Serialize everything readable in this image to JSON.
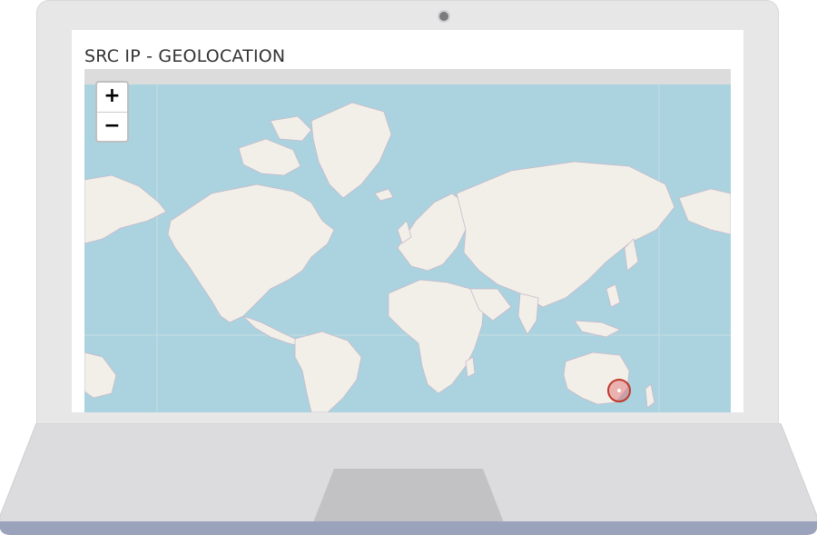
{
  "panel": {
    "title": "SRC IP - GEOLOCATION"
  },
  "map": {
    "zoom_in_label": "+",
    "zoom_out_label": "−",
    "colors": {
      "ocean": "#aad3df",
      "land": "#f2efe9",
      "border": "#c9a3c9",
      "marker_fill": "#e06666",
      "marker_stroke": "#c0392b"
    },
    "markers": [
      {
        "label": "",
        "lat": -37.8,
        "lon": 145.0
      }
    ]
  },
  "device": {
    "lid_color": "#e7e7e8",
    "base_color": "#dcdcde",
    "base_edge_color": "#9aa3bb"
  }
}
